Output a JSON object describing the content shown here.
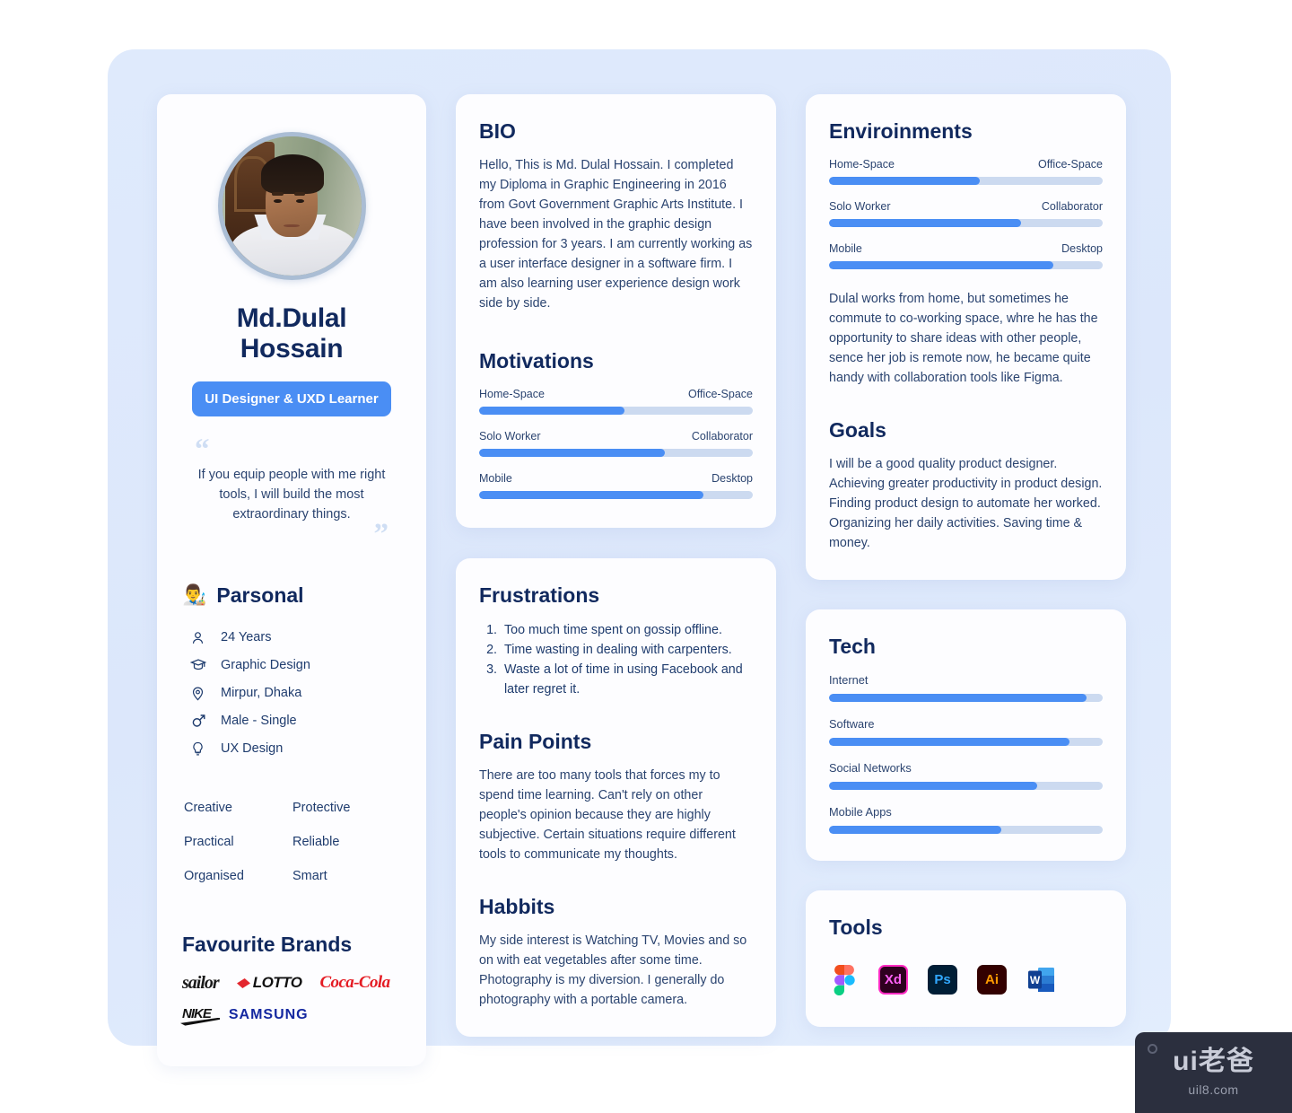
{
  "profile": {
    "name": "Md.Dulal Hossain",
    "role_badge": "UI Designer & UXD Learner",
    "quote_open": "“",
    "quote_close": "”",
    "quote": "If you equip people with me right tools, I will build the most extraordinary things.",
    "personal_heading": "Parsonal",
    "personal_emoji": "👨‍🎨",
    "details": [
      {
        "icon": "person-icon",
        "label": "24 Years"
      },
      {
        "icon": "graduation-cap-icon",
        "label": "Graphic Design"
      },
      {
        "icon": "location-pin-icon",
        "label": "Mirpur, Dhaka"
      },
      {
        "icon": "male-gender-icon",
        "label": "Male - Single"
      },
      {
        "icon": "lightbulb-icon",
        "label": "UX Design"
      }
    ],
    "traits": [
      "Creative",
      "Protective",
      "Practical",
      "Reliable",
      "Organised",
      "Smart"
    ],
    "brands_heading": "Favourite Brands",
    "brands": [
      "sailor",
      "LOTTO",
      "Coca-Cola",
      "NIKE",
      "SAMSUNG"
    ]
  },
  "bio": {
    "heading": "BIO",
    "text": "Hello, This is Md. Dulal Hossain. I completed my Diploma in Graphic Engineering in 2016 from Govt Government Graphic Arts Institute. I have been involved in the graphic design profession for 3 years. I am currently working as a user interface designer in a software firm. I am also learning user experience design work side by side."
  },
  "motivations": {
    "heading": "Motivations",
    "sliders": [
      {
        "left": "Home-Space",
        "right": "Office-Space",
        "value": 53
      },
      {
        "left": "Solo Worker",
        "right": "Collaborator",
        "value": 68
      },
      {
        "left": "Mobile",
        "right": "Desktop",
        "value": 82
      }
    ]
  },
  "frustrations": {
    "heading": "Frustrations",
    "items": [
      "Too much time spent on gossip offline.",
      "Time wasting in dealing with carpenters.",
      "Waste a lot of time in using Facebook and later regret it."
    ]
  },
  "pain_points": {
    "heading": "Pain Points",
    "text": "There are too many tools that forces my to spend time learning. Can't rely on other people's opinion because they are highly subjective. Certain situations require different tools to communicate my thoughts."
  },
  "habbits": {
    "heading": "Habbits",
    "text": "My side interest is Watching TV, Movies and so on with eat vegetables after some time. Photography is my diversion. I generally do photography with a portable camera."
  },
  "environments": {
    "heading": "Enviroinments",
    "sliders": [
      {
        "left": "Home-Space",
        "right": "Office-Space",
        "value": 55
      },
      {
        "left": "Solo Worker",
        "right": "Collaborator",
        "value": 70
      },
      {
        "left": "Mobile",
        "right": "Desktop",
        "value": 82
      }
    ],
    "text": "Dulal works from home, but sometimes he commute to co-working space, whre he has the opportunity to share ideas with other people, sence her job is remote now, he became quite handy with collaboration tools like Figma."
  },
  "goals": {
    "heading": "Goals",
    "text": "I will be a good quality product designer. Achieving greater productivity in product design. Finding product design to automate her worked. Organizing her daily activities. Saving time & money."
  },
  "tech": {
    "heading": "Tech",
    "bars": [
      {
        "label": "Internet",
        "value": 94
      },
      {
        "label": "Software",
        "value": 88
      },
      {
        "label": "Social Networks",
        "value": 76
      },
      {
        "label": "Mobile Apps",
        "value": 63
      }
    ]
  },
  "tools": {
    "heading": "Tools",
    "items": [
      {
        "name": "figma-icon",
        "label": ""
      },
      {
        "name": "adobe-xd-icon",
        "label": "Xd"
      },
      {
        "name": "photoshop-icon",
        "label": "Ps"
      },
      {
        "name": "illustrator-icon",
        "label": "Ai"
      },
      {
        "name": "word-icon",
        "label": "W"
      }
    ]
  },
  "watermark": {
    "main": "ui老爸",
    "sub": "uil8.com"
  },
  "colors": {
    "accent": "#4a8ef4",
    "track": "#ccdaf0",
    "heading": "#11295e",
    "body": "#2b4470",
    "board_bg": "#dce7fb",
    "card_bg": "#fdfdff"
  }
}
